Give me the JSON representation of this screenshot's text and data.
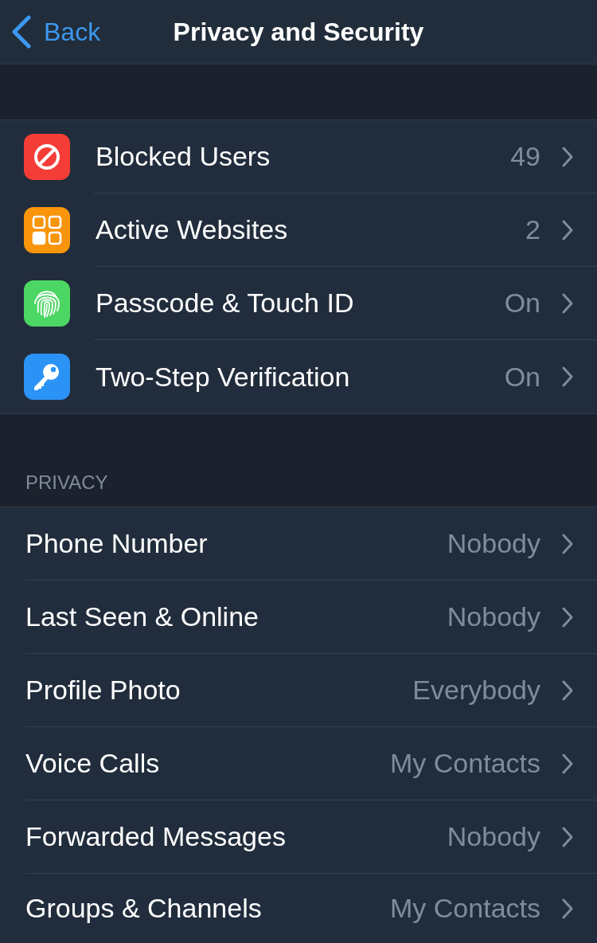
{
  "nav": {
    "back_label": "Back",
    "title": "Privacy and Security"
  },
  "security_items": [
    {
      "kind": "blocked",
      "color": "#f33d36",
      "label": "Blocked Users",
      "value": "49"
    },
    {
      "kind": "websites",
      "color": "#f8950b",
      "label": "Active Websites",
      "value": "2"
    },
    {
      "kind": "fingerprint",
      "color": "#4cd663",
      "label": "Passcode & Touch ID",
      "value": "On"
    },
    {
      "kind": "key",
      "color": "#2b93f5",
      "label": "Two-Step Verification",
      "value": "On"
    }
  ],
  "privacy_section": {
    "header": "PRIVACY",
    "items": [
      {
        "label": "Phone Number",
        "value": "Nobody"
      },
      {
        "label": "Last Seen & Online",
        "value": "Nobody"
      },
      {
        "label": "Profile Photo",
        "value": "Everybody"
      },
      {
        "label": "Voice Calls",
        "value": "My Contacts"
      },
      {
        "label": "Forwarded Messages",
        "value": "Nobody"
      },
      {
        "label": "Groups & Channels",
        "value": "My Contacts"
      }
    ]
  }
}
